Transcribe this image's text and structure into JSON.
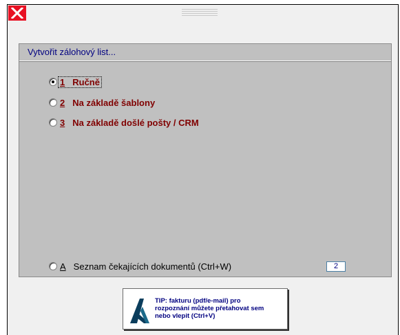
{
  "window": {
    "close_icon": "close-icon",
    "drag_icon": "drag-handle-icon"
  },
  "panel": {
    "title": "Vytvořit zálohový list..."
  },
  "options": [
    {
      "key": "1",
      "label": "Ručně",
      "selected": true
    },
    {
      "key": "2",
      "label": "Na základě šablony",
      "selected": false
    },
    {
      "key": "3",
      "label": "Na základě došlé pošty / CRM",
      "selected": false
    }
  ],
  "waiting": {
    "key": "A",
    "label": "Seznam čekajících dokumentů (Ctrl+W)",
    "count": "2"
  },
  "tip": {
    "line1": "TIP: fakturu (pdf/e-mail) pro",
    "line2": "rozpoznání můžete přetahovat sem",
    "line3": "nebo vlepit (Ctrl+V)",
    "logo_icon": "abra-logo-icon"
  },
  "colors": {
    "close": "#e81123",
    "panel": "#c0c0c0",
    "title": "#000080",
    "option_text": "#800000",
    "tip_text": "#000080"
  }
}
